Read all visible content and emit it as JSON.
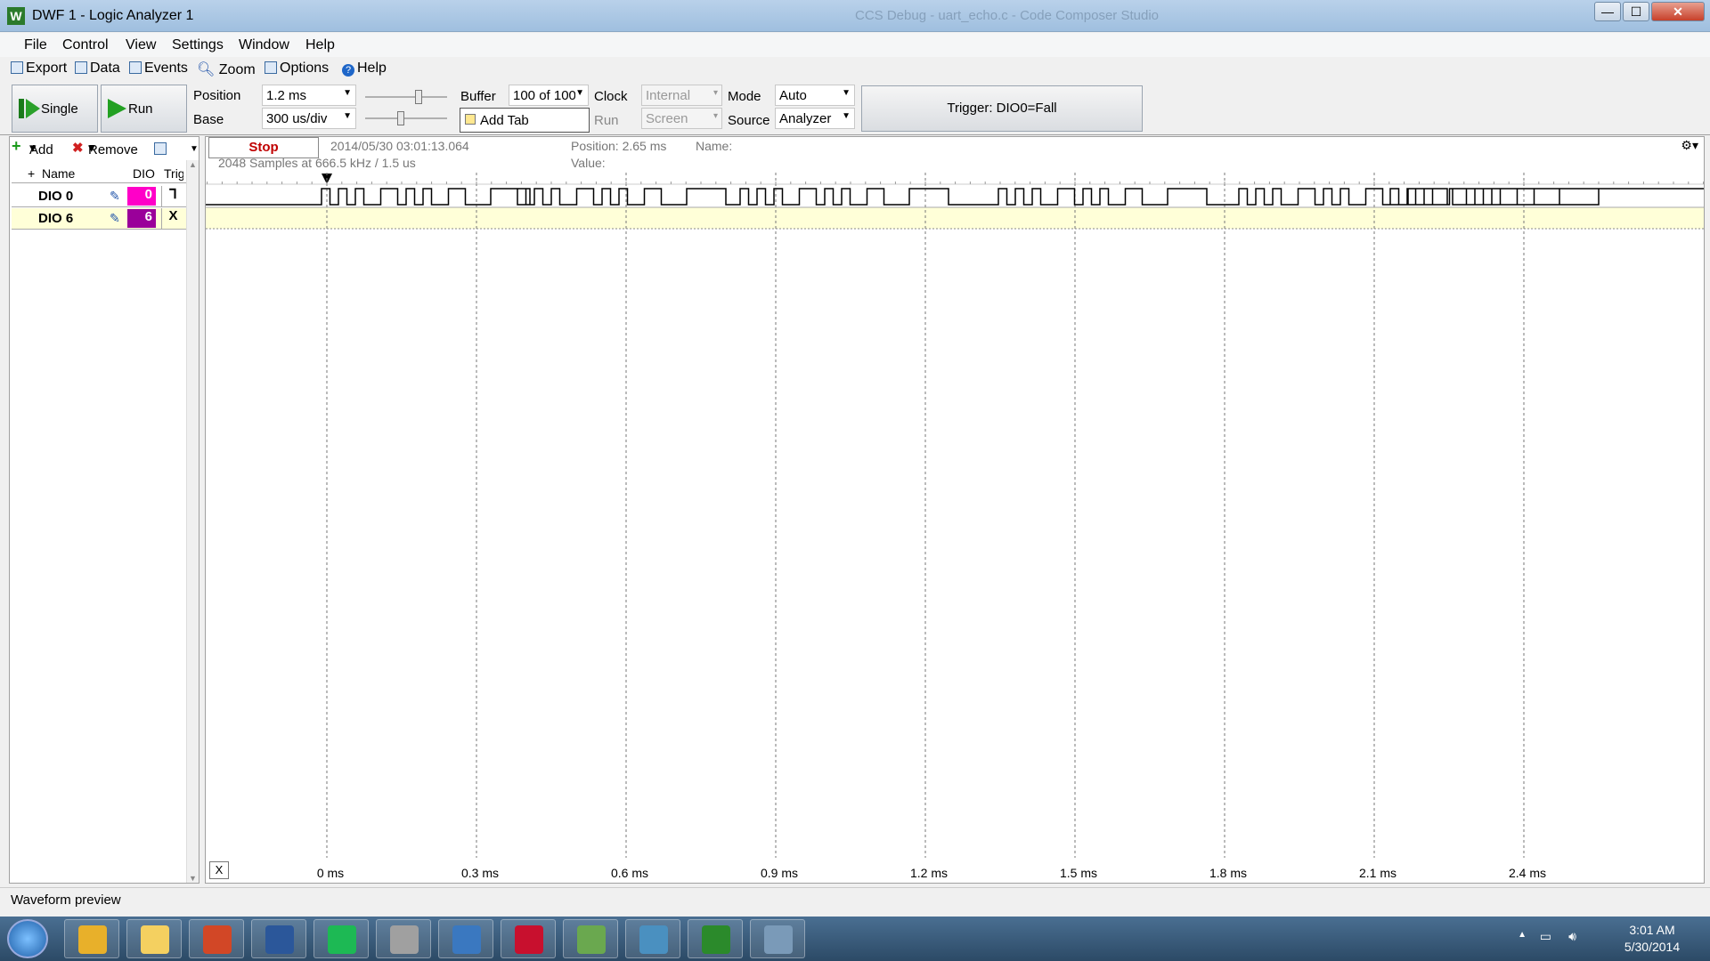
{
  "window": {
    "app_icon": "W",
    "title": "DWF 1 - Logic Analyzer 1",
    "background_title": "CCS Debug - uart_echo.c - Code Composer Studio",
    "min_label": "—",
    "max_label": "☐",
    "close_label": "✕"
  },
  "menu": [
    "File",
    "Control",
    "View",
    "Settings",
    "Window",
    "Help"
  ],
  "toolbar": {
    "export": "Export",
    "data": "Data",
    "events": "Events",
    "zoom": "Zoom",
    "options": "Options",
    "help": "Help"
  },
  "controls": {
    "single": "Single",
    "run": "Run",
    "position_label": "Position",
    "position_value": "1.2 ms",
    "base_label": "Base",
    "base_value": "300 us/div",
    "buffer_label": "Buffer",
    "buffer_value": "100 of 100",
    "add_tab": "Add Tab",
    "clock_label": "Clock",
    "clock_value": "Internal",
    "run_label": "Run",
    "run_value": "Screen",
    "mode_label": "Mode",
    "mode_value": "Auto",
    "source_label": "Source",
    "source_value": "Analyzer",
    "trigger": "Trigger: DIO0=Fall"
  },
  "channels_panel": {
    "add": "Add",
    "remove": "Remove",
    "col_name": "Name",
    "col_dio": "DIO",
    "col_trig": "Trig",
    "rows": [
      {
        "name": "DIO 0",
        "dio": "0",
        "trig": "⅂",
        "color": "#ff00c8"
      },
      {
        "name": "DIO 6",
        "dio": "6",
        "trig": "X",
        "color": "#9a009a"
      }
    ]
  },
  "plot": {
    "stop": "Stop",
    "timestamp": "2014/05/30  03:01:13.064",
    "samples": "2048 Samples at 666.5 kHz / 1.5 us",
    "position": "Position: 2.65 ms",
    "name": "Name:",
    "value": "Value:",
    "x_button": "X",
    "x_ticks": [
      "0 ms",
      "0.3 ms",
      "0.6 ms",
      "0.9 ms",
      "1.2 ms",
      "1.5 ms",
      "1.8 ms",
      "2.1 ms",
      "2.4 ms"
    ]
  },
  "status": "Waveform preview",
  "tray": {
    "time": "3:01 AM",
    "date": "5/30/2014"
  },
  "taskbar_apps": [
    "chrome-icon",
    "explorer-icon",
    "powerpoint-icon",
    "word-icon",
    "spotify-icon",
    "virtualbox-icon",
    "network-icon",
    "acrobat-icon",
    "notepad-icon",
    "remote-desktop-icon",
    "waveforms-icon",
    "calculator-icon"
  ]
}
